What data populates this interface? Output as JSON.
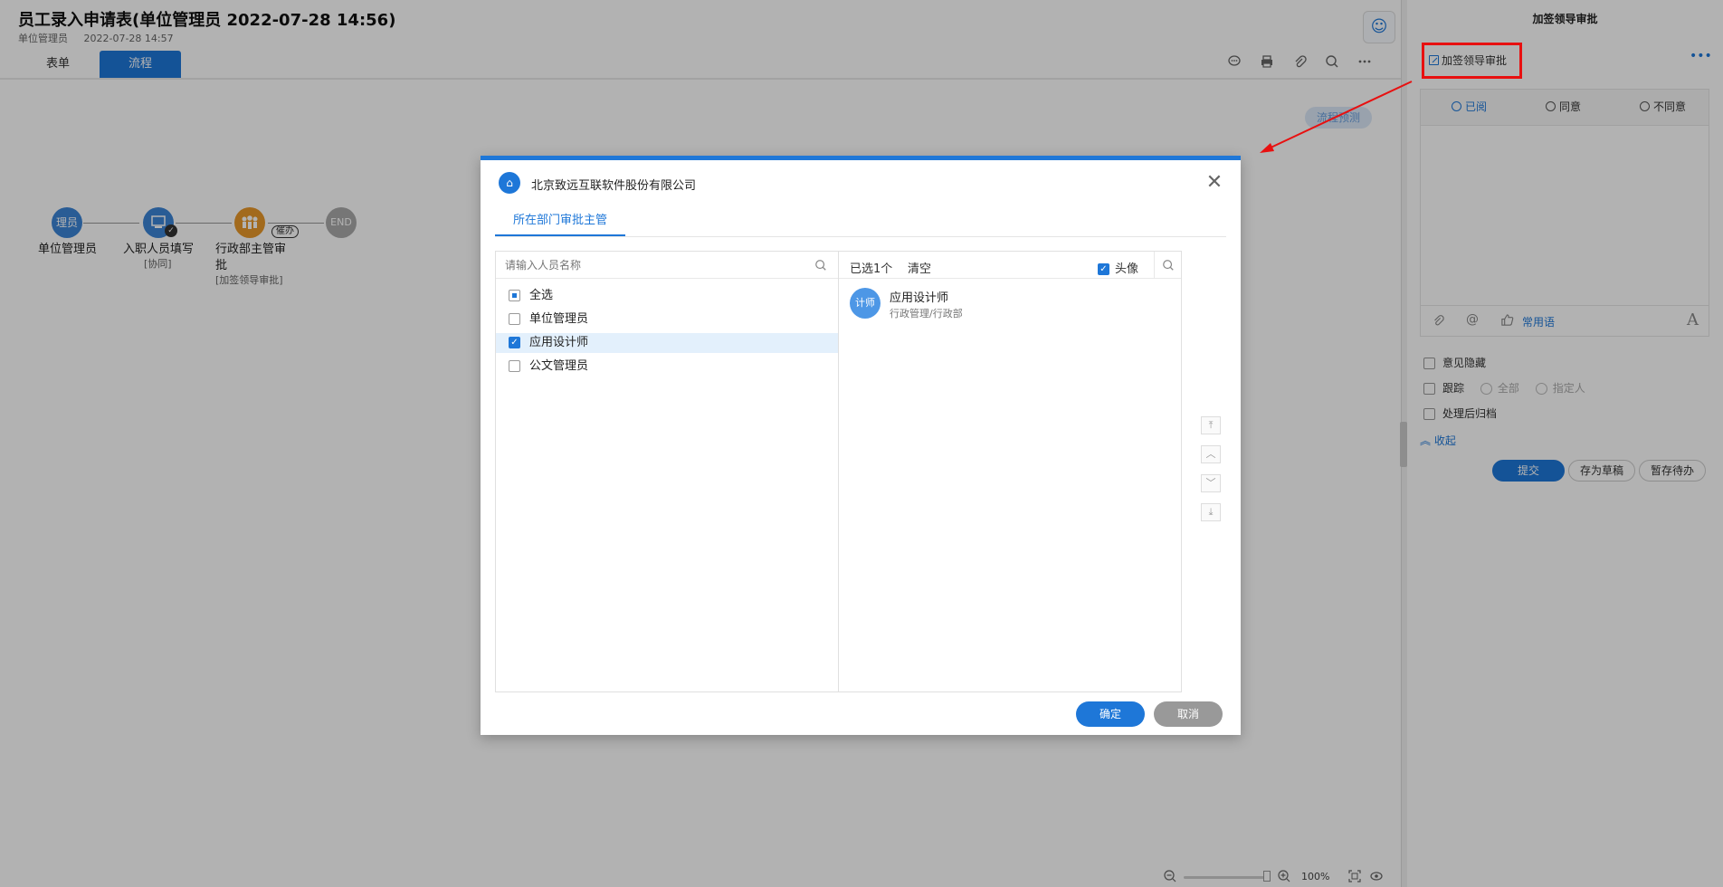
{
  "header": {
    "title": "员工录入申请表(单位管理员 2022-07-28 14:56)",
    "author": "单位管理员",
    "datetime": "2022-07-28 14:57",
    "tabs": [
      "表单",
      "流程"
    ]
  },
  "toolbar": {
    "comment_icon": "comment-icon",
    "print_icon": "print-icon",
    "attach_icon": "attach-icon",
    "search_icon": "search-icon",
    "more_icon": "more-icon",
    "robot_icon": "robot-icon"
  },
  "flow": {
    "preview_label": "流程预测",
    "nodes": [
      {
        "badge": "理员",
        "label": "单位管理员",
        "sub": ""
      },
      {
        "badge": "",
        "label": "入职人员填写",
        "sub": "[协同]"
      },
      {
        "badge": "",
        "label": "行政部主管审批",
        "label_line1": "行政部主管审",
        "label_line2": "批",
        "sub": "[加签领导审批]",
        "tag": "催办"
      },
      {
        "badge": "END",
        "label": "",
        "sub": ""
      }
    ]
  },
  "right_panel": {
    "title": "加签领导审批",
    "action": "加签领导审批",
    "opinions": [
      "已阅",
      "同意",
      "不同意"
    ],
    "common_phrases": "常用语",
    "font_label": "A",
    "options": {
      "hide_opinion": "意见隐藏",
      "track": "跟踪",
      "track_all": "全部",
      "track_specified": "指定人",
      "archive_after": "处理后归档"
    },
    "collapse": "收起",
    "buttons": {
      "submit": "提交",
      "save_draft": "存为草稿",
      "save_pending": "暂存待办"
    }
  },
  "zoom": {
    "level": "100%"
  },
  "dialog": {
    "org": "北京致远互联软件股份有限公司",
    "tab": "所在部门审批主管",
    "search_placeholder": "请输入人员名称",
    "list": [
      {
        "label": "全选",
        "state": "partial"
      },
      {
        "label": "单位管理员",
        "state": "off"
      },
      {
        "label": "应用设计师",
        "state": "on"
      },
      {
        "label": "公文管理员",
        "state": "off"
      }
    ],
    "selected_count": "已选1个",
    "clear": "清空",
    "avatar_toggle": "头像",
    "selected": [
      {
        "avatar": "计师",
        "name": "应用设计师",
        "dept": "行政管理/行政部"
      }
    ],
    "ok": "确定",
    "cancel": "取消"
  },
  "colors": {
    "accent": "#1e77d8",
    "highlight": "#e81010"
  }
}
